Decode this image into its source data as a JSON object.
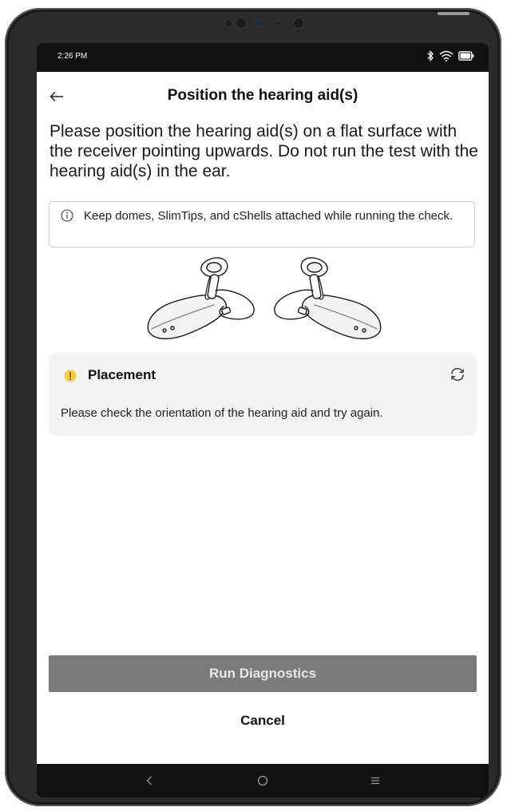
{
  "status_bar": {
    "time": "2:26 PM",
    "icons": [
      "bluetooth-icon",
      "wifi-icon",
      "battery-icon"
    ]
  },
  "header": {
    "back_icon": "arrow-left-icon",
    "title": "Position the hearing aid(s)"
  },
  "instructions": "Please position the hearing aid(s) on a flat surface with the receiver pointing upwards. Do not run the test with the hearing aid(s) in the ear.",
  "info_box": {
    "icon": "info-icon",
    "text": "Keep domes, SlimTips, and cShells attached while running the check."
  },
  "illustration": {
    "icon": "hearing-aids-illustration"
  },
  "status_card": {
    "icon": "warning-icon",
    "title": "Placement",
    "message": "Please check the orientation of the hearing aid and try again.",
    "refresh_icon": "refresh-icon"
  },
  "actions": {
    "run_label": "Run Diagnostics",
    "cancel_label": "Cancel"
  },
  "nav_bar": {
    "items": [
      "nav-back-icon",
      "nav-home-icon",
      "nav-recents-icon"
    ]
  },
  "colors": {
    "warning": "#f7c948",
    "run_button_bg": "#7b7b7b",
    "card_bg": "#f3f3f3",
    "system_bar": "#111111"
  }
}
